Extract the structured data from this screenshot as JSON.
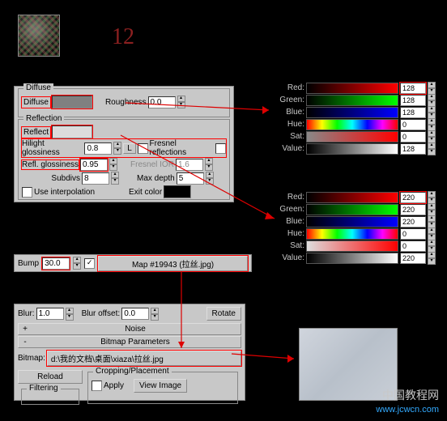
{
  "big_number": "12",
  "material": {
    "diffuse_title": "Diffuse",
    "diffuse_label": "Diffuse",
    "roughness_label": "Roughness",
    "roughness_value": "0.0",
    "reflection_title": "Reflection",
    "reflect_label": "Reflect",
    "hilight_gloss_label": "Hilight glossiness",
    "hilight_gloss_value": "0.8",
    "refl_gloss_label": "Refl. glossiness",
    "refl_gloss_value": "0.95",
    "fresnel_label": "Fresnel reflections",
    "fresnel_ior_label": "Fresnel IOR",
    "fresnel_ior_value": "1.6",
    "subdivs_label": "Subdivs",
    "subdivs_value": "8",
    "max_depth_label": "Max depth",
    "max_depth_value": "5",
    "use_interp_label": "Use interpolation",
    "exit_color_label": "Exit color",
    "l_lock": "L"
  },
  "bump": {
    "label": "Bump",
    "value": "30.0",
    "map_label": "Map #19943 (拉丝.jpg)"
  },
  "bitmap": {
    "blur_label": "Blur:",
    "blur_value": "1.0",
    "blur_offset_label": "Blur offset:",
    "blur_offset_value": "0.0",
    "rotate_label": "Rotate",
    "noise_label": "Noise",
    "params_label": "Bitmap Parameters",
    "bitmap_label": "Bitmap:",
    "bitmap_path": "d:\\我的文档\\桌面\\xiaza\\拉丝.jpg",
    "reload_label": "Reload",
    "cropping_label": "Cropping/Placement",
    "apply_label": "Apply",
    "view_label": "View Image",
    "filtering_label": "Filtering"
  },
  "color1": {
    "r_label": "Red:",
    "r_val": "128",
    "g_label": "Green:",
    "g_val": "128",
    "b_label": "Blue:",
    "b_val": "128",
    "h_label": "Hue:",
    "h_val": "0",
    "s_label": "Sat:",
    "s_val": "0",
    "v_label": "Value:",
    "v_val": "128"
  },
  "color2": {
    "r_label": "Red:",
    "r_val": "220",
    "g_label": "Green:",
    "g_val": "220",
    "b_label": "Blue:",
    "b_val": "220",
    "h_label": "Hue:",
    "h_val": "0",
    "s_label": "Sat:",
    "s_val": "0",
    "v_label": "Value:",
    "v_val": "220"
  },
  "footer": {
    "cn": "中国教程网",
    "url": "www.jcwcn.com"
  }
}
